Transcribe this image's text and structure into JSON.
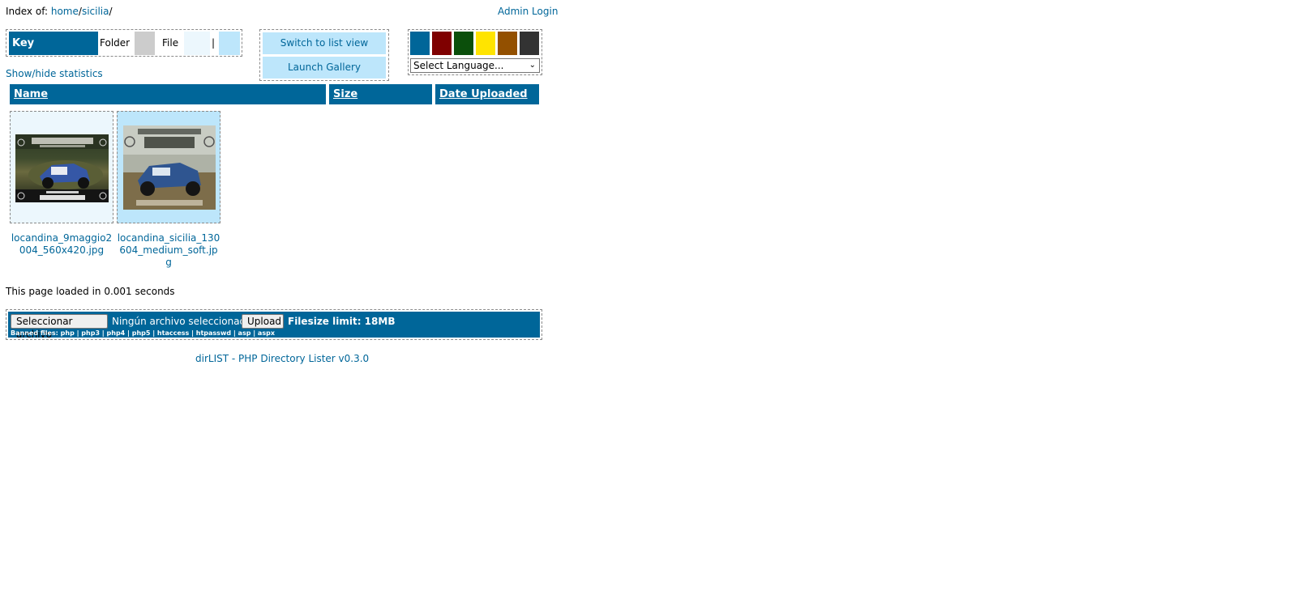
{
  "header": {
    "index_prefix": "Index of:",
    "path_home": "home",
    "path_sep1": "/",
    "path_dir": "sicilia",
    "path_sep2": "/",
    "admin_login": "Admin Login"
  },
  "key": {
    "title": "Key",
    "folder_label": "Folder",
    "file_label": "File",
    "separator": "|",
    "folder_color": "#cccccc",
    "file_color": "#ecf7fd",
    "selected_color": "#bde6fb"
  },
  "stats_link": "Show/hide statistics",
  "view_buttons": {
    "list_view": "Switch to list view",
    "gallery": "Launch Gallery"
  },
  "themes": [
    "#006699",
    "#7f0000",
    "#0b4f0b",
    "#ffe400",
    "#935000",
    "#333333"
  ],
  "language_select": {
    "selected": "Select Language...",
    "caret": "⌄"
  },
  "columns": {
    "name": "Name",
    "size": "Size",
    "date": "Date Uploaded"
  },
  "files": [
    {
      "name": "locandina_9maggio2004_560x420.jpg",
      "thumb_icon": "jeep-summit-poster-thumbnail"
    },
    {
      "name": "locandina_sicilia_130604_medium_soft.jpg",
      "thumb_icon": "jeep-generation-sicilia-thumbnail"
    }
  ],
  "load_time": "This page loaded in 0.001 seconds",
  "upload": {
    "choose_button": "Seleccionar archivo",
    "no_file": "Ningún archivo seleccionado",
    "upload_button": "Upload",
    "limit": "Filesize limit: 18MB",
    "banned": "Banned files: php | php3 | php4 | php5 | htaccess | htpasswd | asp | aspx"
  },
  "footer": "dirLIST - PHP Directory Lister v0.3.0",
  "colors": {
    "accent": "#006699",
    "link": "#006699",
    "tile_file": "#ecf7fd",
    "tile_selected": "#bde6fb"
  }
}
